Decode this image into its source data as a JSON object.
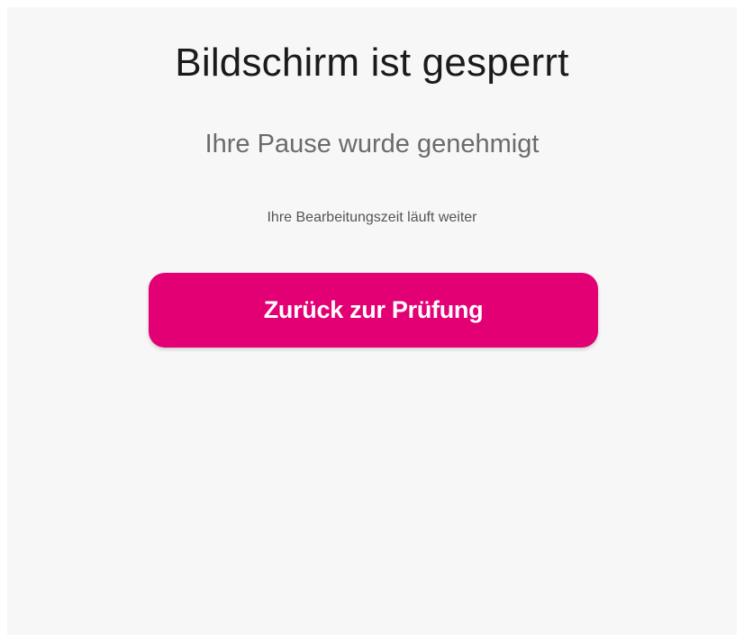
{
  "lock_screen": {
    "title": "Bildschirm ist gesperrt",
    "subtitle": "Ihre Pause wurde genehmigt",
    "note": "Ihre Bearbeitungszeit läuft weiter",
    "button_label": "Zurück zur Prüfung"
  },
  "colors": {
    "accent": "#e20074",
    "background": "#f7f7f7"
  }
}
